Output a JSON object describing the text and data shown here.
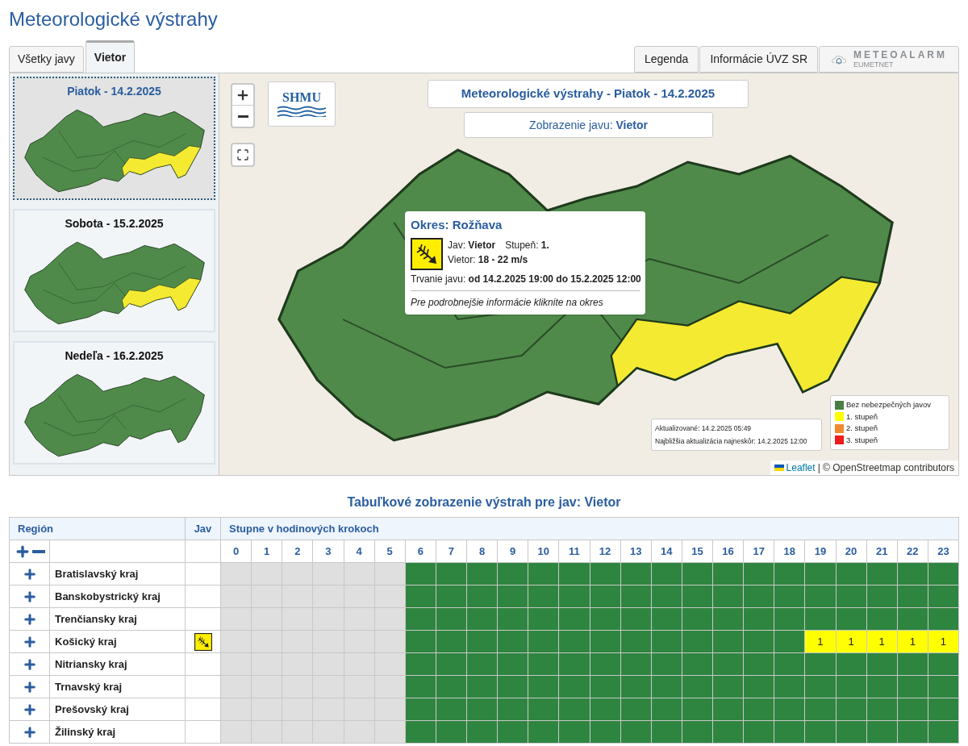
{
  "page_title": "Meteorologické výstrahy",
  "tabs": [
    {
      "label": "Všetky javy",
      "selected": false
    },
    {
      "label": "Vietor",
      "selected": true
    }
  ],
  "header_buttons": [
    "Legenda",
    "Informácie ÚVZ SR"
  ],
  "meteoalarm_logo": {
    "name": "METEOALARM",
    "sub": "EUMETNET"
  },
  "day_cards": [
    {
      "title": "Piatok - 14.2.2025",
      "selected": true,
      "warning": true
    },
    {
      "title": "Sobota - 15.2.2025",
      "selected": false,
      "warning": true
    },
    {
      "title": "Nedeľa - 16.2.2025",
      "selected": false,
      "warning": false
    }
  ],
  "map": {
    "logo": "SHMU",
    "title": "Meteorologické výstrahy - Piatok - 14.2.2025",
    "subtitle": "Zobrazenie javu: **Vietor**",
    "popup": {
      "title": "Okres: Rožňava",
      "phenomenon": "Jav: **Vietor**",
      "grade": "Stupeň: **1.**",
      "wind": "Vietor: **18 - 22 m/s**",
      "duration": "Trvanie javu: **od 14.2.2025 19:00 do 15.2.2025 12:00**",
      "note": "Pre podrobnejšie informácie kliknite na okres"
    },
    "update": {
      "updated": "Aktualizované: 14.2.2025 05:49",
      "next": "Najbližšia aktualizácia najneskôr: 14.2.2025 12:00"
    },
    "legend": [
      {
        "label": "Bez nebezpečných javov",
        "color": "#4a7f43"
      },
      {
        "label": "1. stupeň",
        "color": "#ffff00"
      },
      {
        "label": "2. stupeň",
        "color": "#f08a30"
      },
      {
        "label": "3. stupeň",
        "color": "#ee1c1c"
      }
    ],
    "attribution_link": "Leaflet",
    "attribution_text": "| © OpenStreetmap contributors"
  },
  "table": {
    "title": "Tabuľkové zobrazenie výstrah pre jav: Vietor",
    "group_headings": [
      "Región",
      "Jav",
      "Stupne v hodinových krokoch"
    ],
    "hours": [
      "0",
      "1",
      "2",
      "3",
      "4",
      "5",
      "6",
      "7",
      "8",
      "9",
      "10",
      "11",
      "12",
      "13",
      "14",
      "15",
      "16",
      "17",
      "18",
      "19",
      "20",
      "21",
      "22",
      "23"
    ],
    "rows": [
      {
        "region": "Bratislavský kraj",
        "has_warning_icon": false,
        "cells": [
          {
            "color": "#e0dfdf"
          },
          {
            "color": "#e0dfdf"
          },
          {
            "color": "#e0dfdf"
          },
          {
            "color": "#e0dfdf"
          },
          {
            "color": "#e0dfdf"
          },
          {
            "color": "#e0dfdf"
          },
          {
            "color": "#2e8540"
          },
          {
            "color": "#2e8540"
          },
          {
            "color": "#2e8540"
          },
          {
            "color": "#2e8540"
          },
          {
            "color": "#2e8540"
          },
          {
            "color": "#2e8540"
          },
          {
            "color": "#2e8540"
          },
          {
            "color": "#2e8540"
          },
          {
            "color": "#2e8540"
          },
          {
            "color": "#2e8540"
          },
          {
            "color": "#2e8540"
          },
          {
            "color": "#2e8540"
          },
          {
            "color": "#2e8540"
          },
          {
            "color": "#2e8540"
          },
          {
            "color": "#2e8540"
          },
          {
            "color": "#2e8540"
          },
          {
            "color": "#2e8540"
          },
          {
            "color": "#2e8540"
          }
        ]
      },
      {
        "region": "Banskobystrický kraj",
        "has_warning_icon": false,
        "cells": [
          {
            "color": "#e0dfdf"
          },
          {
            "color": "#e0dfdf"
          },
          {
            "color": "#e0dfdf"
          },
          {
            "color": "#e0dfdf"
          },
          {
            "color": "#e0dfdf"
          },
          {
            "color": "#e0dfdf"
          },
          {
            "color": "#2e8540"
          },
          {
            "color": "#2e8540"
          },
          {
            "color": "#2e8540"
          },
          {
            "color": "#2e8540"
          },
          {
            "color": "#2e8540"
          },
          {
            "color": "#2e8540"
          },
          {
            "color": "#2e8540"
          },
          {
            "color": "#2e8540"
          },
          {
            "color": "#2e8540"
          },
          {
            "color": "#2e8540"
          },
          {
            "color": "#2e8540"
          },
          {
            "color": "#2e8540"
          },
          {
            "color": "#2e8540"
          },
          {
            "color": "#2e8540"
          },
          {
            "color": "#2e8540"
          },
          {
            "color": "#2e8540"
          },
          {
            "color": "#2e8540"
          },
          {
            "color": "#2e8540"
          }
        ]
      },
      {
        "region": "Trenčiansky kraj",
        "has_warning_icon": false,
        "cells": [
          {
            "color": "#e0dfdf"
          },
          {
            "color": "#e0dfdf"
          },
          {
            "color": "#e0dfdf"
          },
          {
            "color": "#e0dfdf"
          },
          {
            "color": "#e0dfdf"
          },
          {
            "color": "#e0dfdf"
          },
          {
            "color": "#2e8540"
          },
          {
            "color": "#2e8540"
          },
          {
            "color": "#2e8540"
          },
          {
            "color": "#2e8540"
          },
          {
            "color": "#2e8540"
          },
          {
            "color": "#2e8540"
          },
          {
            "color": "#2e8540"
          },
          {
            "color": "#2e8540"
          },
          {
            "color": "#2e8540"
          },
          {
            "color": "#2e8540"
          },
          {
            "color": "#2e8540"
          },
          {
            "color": "#2e8540"
          },
          {
            "color": "#2e8540"
          },
          {
            "color": "#2e8540"
          },
          {
            "color": "#2e8540"
          },
          {
            "color": "#2e8540"
          },
          {
            "color": "#2e8540"
          },
          {
            "color": "#2e8540"
          }
        ]
      },
      {
        "region": "Košický kraj",
        "has_warning_icon": true,
        "cells": [
          {
            "color": "#e0dfdf"
          },
          {
            "color": "#e0dfdf"
          },
          {
            "color": "#e0dfdf"
          },
          {
            "color": "#e0dfdf"
          },
          {
            "color": "#e0dfdf"
          },
          {
            "color": "#e0dfdf"
          },
          {
            "color": "#2e8540"
          },
          {
            "color": "#2e8540"
          },
          {
            "color": "#2e8540"
          },
          {
            "color": "#2e8540"
          },
          {
            "color": "#2e8540"
          },
          {
            "color": "#2e8540"
          },
          {
            "color": "#2e8540"
          },
          {
            "color": "#2e8540"
          },
          {
            "color": "#2e8540"
          },
          {
            "color": "#2e8540"
          },
          {
            "color": "#2e8540"
          },
          {
            "color": "#2e8540"
          },
          {
            "color": "#2e8540"
          },
          {
            "color": "#ffff00",
            "text": "1"
          },
          {
            "color": "#ffff00",
            "text": "1"
          },
          {
            "color": "#ffff00",
            "text": "1"
          },
          {
            "color": "#ffff00",
            "text": "1"
          },
          {
            "color": "#ffff00",
            "text": "1"
          }
        ]
      },
      {
        "region": "Nitriansky kraj",
        "has_warning_icon": false,
        "cells": [
          {
            "color": "#e0dfdf"
          },
          {
            "color": "#e0dfdf"
          },
          {
            "color": "#e0dfdf"
          },
          {
            "color": "#e0dfdf"
          },
          {
            "color": "#e0dfdf"
          },
          {
            "color": "#e0dfdf"
          },
          {
            "color": "#2e8540"
          },
          {
            "color": "#2e8540"
          },
          {
            "color": "#2e8540"
          },
          {
            "color": "#2e8540"
          },
          {
            "color": "#2e8540"
          },
          {
            "color": "#2e8540"
          },
          {
            "color": "#2e8540"
          },
          {
            "color": "#2e8540"
          },
          {
            "color": "#2e8540"
          },
          {
            "color": "#2e8540"
          },
          {
            "color": "#2e8540"
          },
          {
            "color": "#2e8540"
          },
          {
            "color": "#2e8540"
          },
          {
            "color": "#2e8540"
          },
          {
            "color": "#2e8540"
          },
          {
            "color": "#2e8540"
          },
          {
            "color": "#2e8540"
          },
          {
            "color": "#2e8540"
          }
        ]
      },
      {
        "region": "Trnavský kraj",
        "has_warning_icon": false,
        "cells": [
          {
            "color": "#e0dfdf"
          },
          {
            "color": "#e0dfdf"
          },
          {
            "color": "#e0dfdf"
          },
          {
            "color": "#e0dfdf"
          },
          {
            "color": "#e0dfdf"
          },
          {
            "color": "#e0dfdf"
          },
          {
            "color": "#2e8540"
          },
          {
            "color": "#2e8540"
          },
          {
            "color": "#2e8540"
          },
          {
            "color": "#2e8540"
          },
          {
            "color": "#2e8540"
          },
          {
            "color": "#2e8540"
          },
          {
            "color": "#2e8540"
          },
          {
            "color": "#2e8540"
          },
          {
            "color": "#2e8540"
          },
          {
            "color": "#2e8540"
          },
          {
            "color": "#2e8540"
          },
          {
            "color": "#2e8540"
          },
          {
            "color": "#2e8540"
          },
          {
            "color": "#2e8540"
          },
          {
            "color": "#2e8540"
          },
          {
            "color": "#2e8540"
          },
          {
            "color": "#2e8540"
          },
          {
            "color": "#2e8540"
          }
        ]
      },
      {
        "region": "Prešovský kraj",
        "has_warning_icon": false,
        "cells": [
          {
            "color": "#e0dfdf"
          },
          {
            "color": "#e0dfdf"
          },
          {
            "color": "#e0dfdf"
          },
          {
            "color": "#e0dfdf"
          },
          {
            "color": "#e0dfdf"
          },
          {
            "color": "#e0dfdf"
          },
          {
            "color": "#2e8540"
          },
          {
            "color": "#2e8540"
          },
          {
            "color": "#2e8540"
          },
          {
            "color": "#2e8540"
          },
          {
            "color": "#2e8540"
          },
          {
            "color": "#2e8540"
          },
          {
            "color": "#2e8540"
          },
          {
            "color": "#2e8540"
          },
          {
            "color": "#2e8540"
          },
          {
            "color": "#2e8540"
          },
          {
            "color": "#2e8540"
          },
          {
            "color": "#2e8540"
          },
          {
            "color": "#2e8540"
          },
          {
            "color": "#2e8540"
          },
          {
            "color": "#2e8540"
          },
          {
            "color": "#2e8540"
          },
          {
            "color": "#2e8540"
          },
          {
            "color": "#2e8540"
          }
        ]
      },
      {
        "region": "Žilinský kraj",
        "has_warning_icon": false,
        "cells": [
          {
            "color": "#e0dfdf"
          },
          {
            "color": "#e0dfdf"
          },
          {
            "color": "#e0dfdf"
          },
          {
            "color": "#e0dfdf"
          },
          {
            "color": "#e0dfdf"
          },
          {
            "color": "#e0dfdf"
          },
          {
            "color": "#2e8540"
          },
          {
            "color": "#2e8540"
          },
          {
            "color": "#2e8540"
          },
          {
            "color": "#2e8540"
          },
          {
            "color": "#2e8540"
          },
          {
            "color": "#2e8540"
          },
          {
            "color": "#2e8540"
          },
          {
            "color": "#2e8540"
          },
          {
            "color": "#2e8540"
          },
          {
            "color": "#2e8540"
          },
          {
            "color": "#2e8540"
          },
          {
            "color": "#2e8540"
          },
          {
            "color": "#2e8540"
          },
          {
            "color": "#2e8540"
          },
          {
            "color": "#2e8540"
          },
          {
            "color": "#2e8540"
          },
          {
            "color": "#2e8540"
          },
          {
            "color": "#2e8540"
          }
        ]
      }
    ]
  }
}
